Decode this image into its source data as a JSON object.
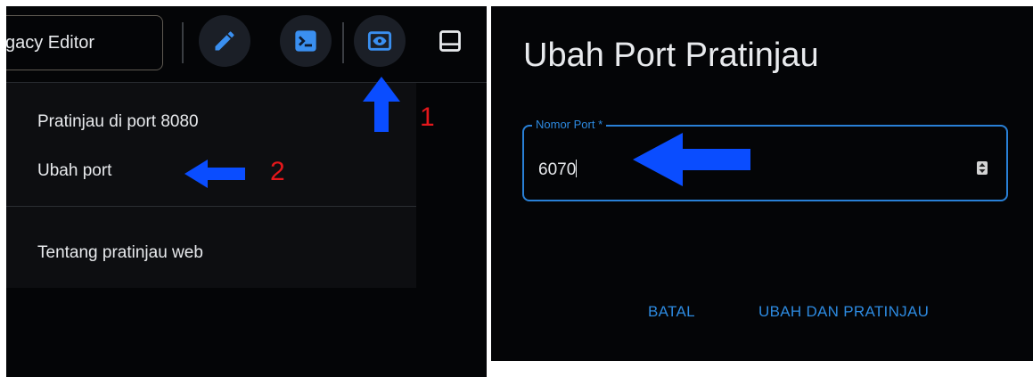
{
  "toolbar": {
    "legacy_editor_label": "gacy Editor",
    "icons": [
      "pencil-icon",
      "terminal-icon",
      "web-preview-icon",
      "panel-icon"
    ]
  },
  "menu": {
    "items": [
      {
        "label": "Pratinjau di port 8080"
      },
      {
        "label": "Ubah port"
      },
      {
        "label": "Tentang pratinjau web"
      }
    ]
  },
  "annotations": {
    "step1": "1",
    "step2": "2",
    "arrow_color": "#0a4dff",
    "number_color": "#e4171b"
  },
  "dialog": {
    "title": "Ubah Port Pratinjau",
    "field_label": "Nomor Port *",
    "field_value": "6070",
    "cancel_label": "BATAL",
    "confirm_label": "UBAH DAN PRATINJAU"
  },
  "colors": {
    "background": "#040507",
    "accent": "#2d8ae0",
    "text": "#e8eaed"
  }
}
